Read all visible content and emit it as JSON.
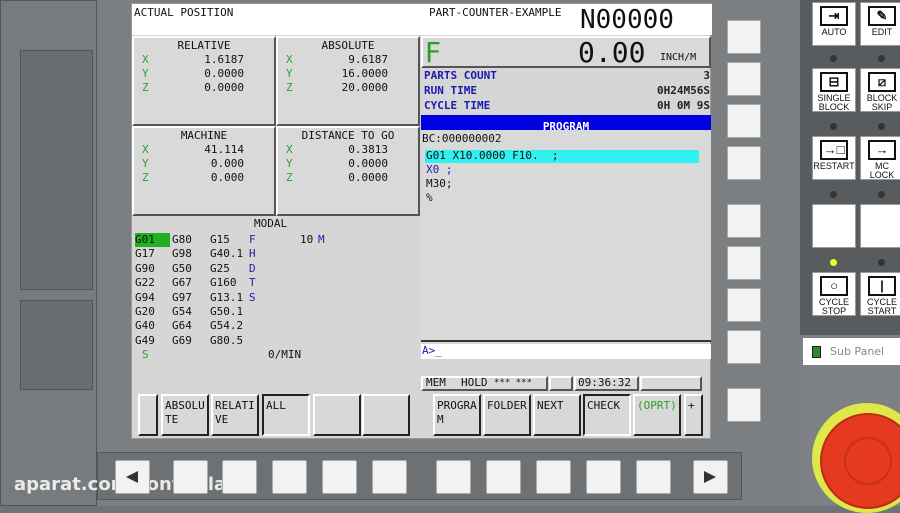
{
  "header": {
    "screen_title": "ACTUAL POSITION",
    "program_name": "PART-COUNTER-EXAMPLE",
    "sequence_number": "N00000"
  },
  "positions": {
    "relative": {
      "title": "RELATIVE",
      "axes": [
        {
          "axis": "X",
          "value": "1.6187"
        },
        {
          "axis": "Y",
          "value": "0.0000"
        },
        {
          "axis": "Z",
          "value": "0.0000"
        }
      ]
    },
    "absolute": {
      "title": "ABSOLUTE",
      "axes": [
        {
          "axis": "X",
          "value": "9.6187"
        },
        {
          "axis": "Y",
          "value": "16.0000"
        },
        {
          "axis": "Z",
          "value": "20.0000"
        }
      ]
    },
    "machine": {
      "title": "MACHINE",
      "axes": [
        {
          "axis": "X",
          "value": "41.114"
        },
        {
          "axis": "Y",
          "value": "0.000"
        },
        {
          "axis": "Z",
          "value": "0.000"
        }
      ]
    },
    "distance": {
      "title": "DISTANCE TO GO",
      "axes": [
        {
          "axis": "X",
          "value": "0.3813"
        },
        {
          "axis": "Y",
          "value": "0.0000"
        },
        {
          "axis": "Z",
          "value": "0.0000"
        }
      ]
    }
  },
  "feed": {
    "label": "F",
    "value": "0.00",
    "unit": "INCH/M"
  },
  "counters": [
    {
      "label": "PARTS COUNT",
      "value": "3"
    },
    {
      "label": "RUN TIME",
      "value": "0H24M56S"
    },
    {
      "label": "CYCLE TIME",
      "value": "0H 0M 9S"
    }
  ],
  "program": {
    "title": "PROGRAM",
    "block_counter": "BC:000000002",
    "lines": [
      "G01 X10.0000 F10.  ;",
      "X0 ;",
      "M30;",
      "%"
    ],
    "prompt": "A>_"
  },
  "modal": {
    "title": "MODAL",
    "rows": [
      [
        "G01",
        "G80",
        "G15",
        "F",
        "10",
        "M"
      ],
      [
        "G17",
        "G98",
        "G40.1",
        "H",
        "",
        ""
      ],
      [
        "G90",
        "G50",
        "G25",
        "D",
        "",
        ""
      ],
      [
        "G22",
        "G67",
        "G160",
        "T",
        "",
        ""
      ],
      [
        "G94",
        "G97",
        "G13.1",
        "S",
        "",
        ""
      ],
      [
        "G20",
        "G54",
        "G50.1",
        "",
        "",
        ""
      ],
      [
        "G40",
        "G64",
        "G54.2",
        "",
        "",
        ""
      ],
      [
        "G49",
        "G69",
        "G80.5",
        "",
        "",
        ""
      ]
    ],
    "spindle_label": "S",
    "spindle_value": "0/MIN"
  },
  "status": {
    "mode": "MEM",
    "state": "HOLD",
    "alarms": "*** ***",
    "time": "09:36:32"
  },
  "softkeys": [
    "",
    "ABSOLU\nTE",
    "RELATI\nVE",
    "ALL",
    "",
    "",
    "PROGRA\nM",
    "FOLDER",
    "NEXT",
    "CHECK",
    "(OPRT)",
    "+"
  ],
  "operator_panel": [
    {
      "label": "AUTO",
      "icon": "arrow-into-box"
    },
    {
      "label": "EDIT",
      "icon": "edit-pen"
    },
    {
      "label": "SINGLE\nBLOCK",
      "icon": "single-block"
    },
    {
      "label": "BLOCK\nSKIP",
      "icon": "block-skip"
    },
    {
      "label": "RESTART",
      "icon": "restart"
    },
    {
      "label": "MC\nLOCK",
      "icon": "machine-lock"
    },
    {
      "label": "",
      "icon": ""
    },
    {
      "label": "",
      "icon": ""
    },
    {
      "label": "CYCLE\nSTOP",
      "icon": "circle"
    },
    {
      "label": "CYCLE\nSTART",
      "icon": "bar"
    }
  ],
  "sub_panel": {
    "title": "Sub Panel"
  },
  "watermark": "aparat.com/controlla",
  "colors": {
    "accent_purple": "#a020a0",
    "axis_green": "#2aa02a",
    "program_bar": "#0000e0",
    "highlight_cyan": "#33f0f0",
    "modal_highlight": "#22b022",
    "led_on": "#e8ff30",
    "estop_red": "#e53a20"
  }
}
